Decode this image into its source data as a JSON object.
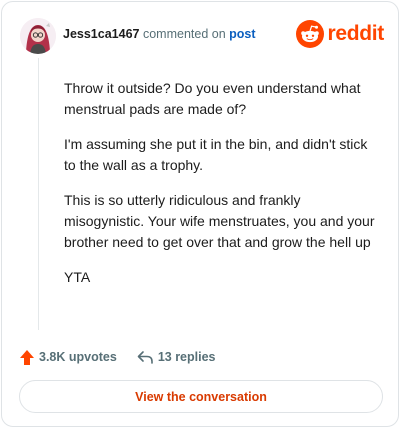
{
  "header": {
    "username": "Jess1ca1467",
    "action_text": "commented on",
    "post_link": "post",
    "brand_name": "reddit"
  },
  "comment": {
    "paragraphs": [
      "Throw it outside? Do you even understand what menstrual pads are made of?",
      "I'm assuming she put it in the bin, and didn't stick to the wall as a trophy.",
      "This is so utterly ridiculous and frankly misogynistic. Your wife menstruates, you and your brother need to get over that and grow the hell up",
      "YTA"
    ]
  },
  "footer": {
    "upvotes": "3.8K upvotes",
    "replies": "13 replies",
    "cta_label": "View the conversation"
  },
  "icons": {
    "avatar": "avatar-icon",
    "brand": "reddit-logo-icon",
    "upvote": "upvote-arrow-icon",
    "reply": "reply-arrow-icon"
  },
  "colors": {
    "brand_orange": "#ff4500",
    "upvote_orange": "#ff4500",
    "cta_text": "#d93a00",
    "link_blue": "#0b5fbf",
    "meta_gray": "#576f76"
  }
}
